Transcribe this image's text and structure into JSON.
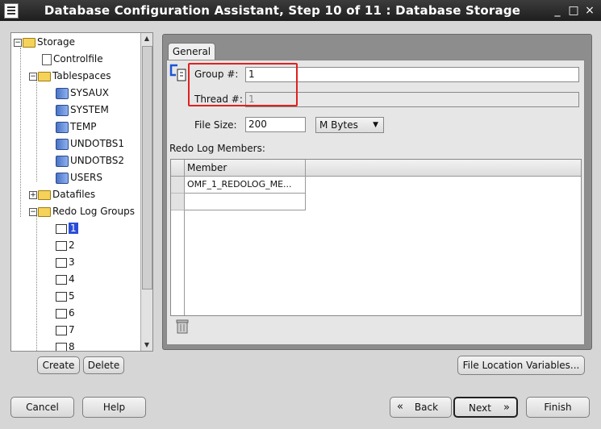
{
  "window": {
    "title": "Database Configuration Assistant, Step 10 of 11 : Database Storage",
    "min_symbol": "_",
    "max_symbol": "□",
    "close_symbol": "×"
  },
  "tree": {
    "root": "Storage",
    "items": [
      "Controlfile",
      "Tablespaces",
      "SYSAUX",
      "SYSTEM",
      "TEMP",
      "UNDOTBS1",
      "UNDOTBS2",
      "USERS",
      "Datafiles",
      "Redo Log Groups",
      "1",
      "2",
      "3",
      "4",
      "5",
      "6",
      "7",
      "8"
    ],
    "selected": "1"
  },
  "buttons": {
    "create": "Create",
    "delete": "Delete",
    "file_location_variables": "File Location Variables...",
    "cancel": "Cancel",
    "help": "Help",
    "back": "Back",
    "next": "Next",
    "finish": "Finish"
  },
  "tabs": {
    "general": "General"
  },
  "form": {
    "group_label": "Group #:",
    "group_value": "1",
    "thread_label": "Thread #:",
    "thread_value": "1",
    "file_size_label": "File Size:",
    "file_size_value": "200",
    "unit_value": "M Bytes",
    "members_label": "Redo Log Members:"
  },
  "table": {
    "column_member": "Member",
    "rows": [
      "OMF_1_REDOLOG_ME...",
      ""
    ]
  },
  "colors": {
    "highlight_box": "#e02020",
    "selection": "#2a4dd8"
  }
}
